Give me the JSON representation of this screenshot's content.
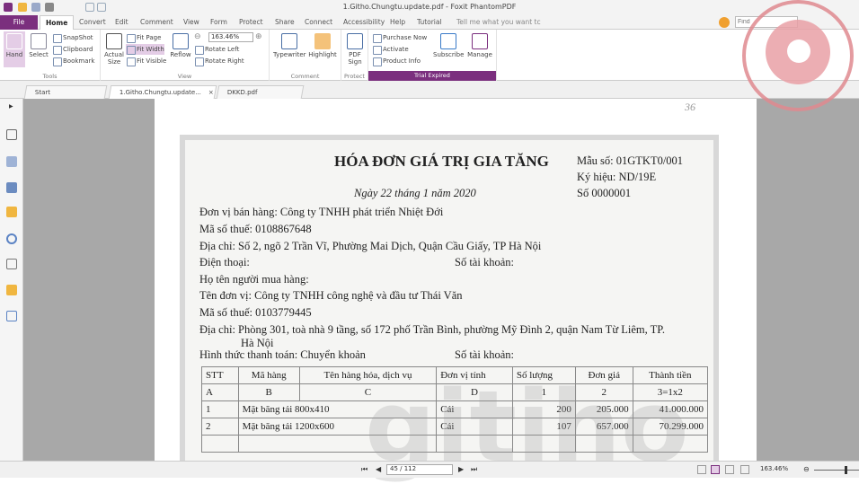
{
  "window": {
    "title": "1.Githo.Chungtu.update.pdf - Foxit PhantomPDF"
  },
  "ribbon_tabs": [
    "File",
    "Home",
    "Convert",
    "Edit",
    "Comment",
    "View",
    "Form",
    "Protect",
    "Share",
    "Connect",
    "Accessibility",
    "Help",
    "Tutorial"
  ],
  "tell_me": "Tell me what you want tc",
  "find_placeholder": "Find",
  "tools": {
    "hand": "Hand",
    "select": "Select",
    "snapshot": "SnapShot",
    "clipboard": "Clipboard",
    "bookmark": "Bookmark",
    "label": "Tools"
  },
  "view": {
    "actual_size": "Actual Size",
    "fit_page": "Fit Page",
    "fit_width": "Fit Width",
    "fit_visible": "Fit Visible",
    "reflow": "Reflow",
    "zoom": "163.46%",
    "rotate_left": "Rotate Left",
    "rotate_right": "Rotate Right",
    "label": "View"
  },
  "comment": {
    "typewriter": "Typewriter",
    "highlight": "Highlight",
    "label": "Comment"
  },
  "protect": {
    "pdf_sign": "PDF Sign",
    "label": "Protect"
  },
  "trial": {
    "purchase": "Purchase Now",
    "activate": "Activate",
    "product_info": "Product Info",
    "subscribe": "Subscribe",
    "manage": "Manage",
    "label": "Trial Expired"
  },
  "doc_tabs": [
    "Start",
    "1.Githo.Chungtu.update...",
    "DKKD.pdf"
  ],
  "invoice": {
    "page_mark": "36",
    "title": "HÓA ĐƠN GIÁ TRỊ GIA TĂNG",
    "mau_so": "Mẫu số: 01GTKT0/001",
    "ky_hieu": "Ký hiệu:  ND/19E",
    "so": "Số  0000001",
    "date": "Ngày   22  tháng   1   năm   2020",
    "seller": "Đơn vị bán hàng:  Công ty TNHH phát triển Nhiệt Đới",
    "seller_tax": "Mã số thuế:  0108867648",
    "seller_addr": "Địa chỉ: Số 2, ngõ 2 Trần Vĩ, Phường Mai Dịch, Quận Cầu Giấy, TP Hà Nội",
    "phone": "Điện thoại:",
    "account": "Số tài khoản:",
    "buyer": "Họ tên người mua hàng:",
    "buyer_unit": "Tên đơn vị:  Công ty TNHH công nghệ và đầu tư Thái Văn",
    "buyer_tax": "Mã số thuế:  0103779445",
    "buyer_addr": "Địa chỉ: Phòng 301, toà nhà 9 tầng, số 172 phố Trần Bình, phường Mỹ Đình 2, quận Nam Từ Liêm, TP.",
    "buyer_addr2": "Hà Nội",
    "payment": "Hình thức thanh toán:  Chuyển khoản",
    "account2": "Số tài khoản:",
    "headers": [
      "STT",
      "Mã hàng",
      "Tên hàng hóa, dịch vụ",
      "Đơn vị tính",
      "Số lượng",
      "Đơn giá",
      "Thành tiền"
    ],
    "codes": [
      "A",
      "B",
      "C",
      "D",
      "1",
      "2",
      "3=1x2"
    ],
    "rows": [
      [
        "1",
        "Mặt băng tải 800x410",
        "",
        "Cái",
        "200",
        "205.000",
        "41.000.000"
      ],
      [
        "2",
        "Mặt băng tải 1200x600",
        "",
        "Cái",
        "107",
        "657.000",
        "70.299.000"
      ]
    ]
  },
  "status": {
    "page": "45 / 112",
    "zoom": "163.46%"
  },
  "watermark": "gitiho"
}
